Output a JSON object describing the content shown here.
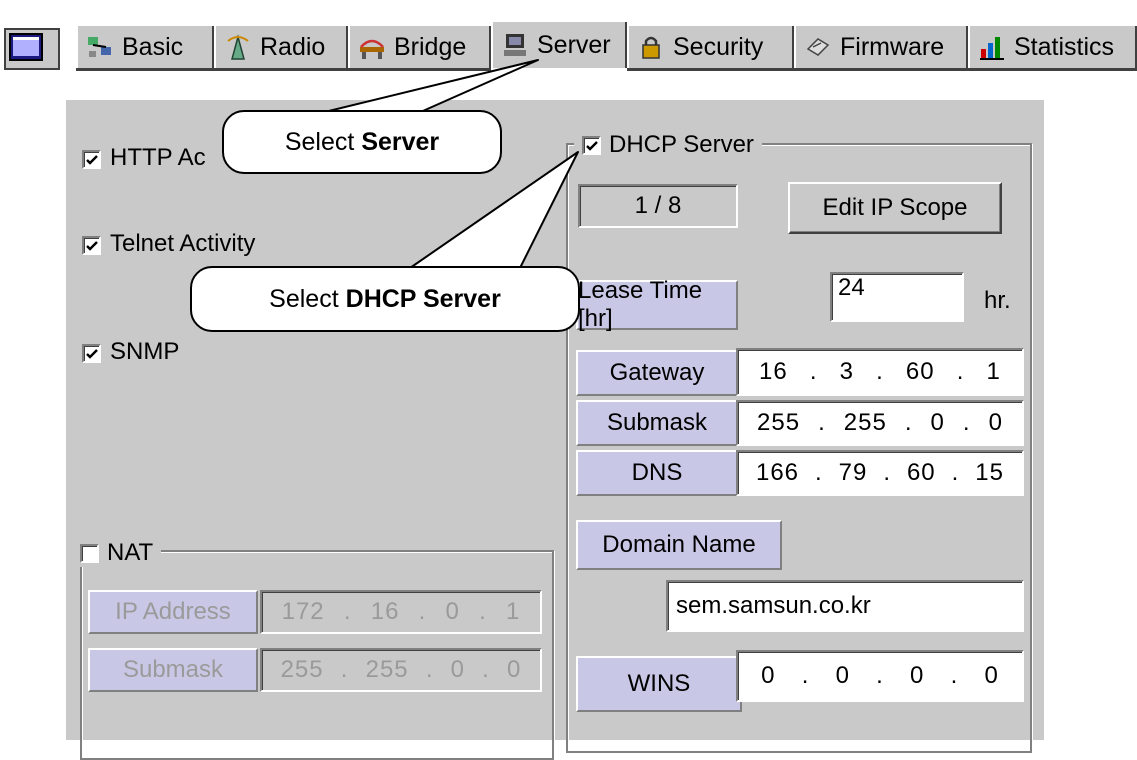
{
  "tabs": [
    {
      "label": "Basic",
      "icon": "network-map-icon"
    },
    {
      "label": "Radio",
      "icon": "radio-tower-icon"
    },
    {
      "label": "Bridge",
      "icon": "bridge-icon"
    },
    {
      "label": "Server",
      "icon": "server-computer-icon",
      "selected": true
    },
    {
      "label": "Security",
      "icon": "security-padlock-icon"
    },
    {
      "label": "Firmware",
      "icon": "firmware-chip-icon"
    },
    {
      "label": "Statistics",
      "icon": "bar-chart-icon"
    }
  ],
  "left": {
    "http_label": "HTTP Ac",
    "http_checked": true,
    "telnet_label": "Telnet Activity",
    "telnet_checked": true,
    "snmp_label": "SNMP",
    "snmp_checked": true
  },
  "nat": {
    "title": "NAT",
    "checked": false,
    "ip_label": "IP Address",
    "ip_value": [
      "172",
      "16",
      "0",
      "1"
    ],
    "submask_label": "Submask",
    "submask_value": [
      "255",
      "255",
      "0",
      "0"
    ]
  },
  "dhcp": {
    "title": "DHCP Server",
    "checked": true,
    "scope_count": "1 / 8",
    "edit_scope_button": "Edit IP Scope",
    "lease_label": "Lease Time [hr]",
    "lease_value": "24",
    "lease_unit": "hr.",
    "gateway_label": "Gateway",
    "gateway_value": [
      "16",
      "3",
      "60",
      "1"
    ],
    "submask_label": "Submask",
    "submask_value": [
      "255",
      "255",
      "0",
      "0"
    ],
    "dns_label": "DNS",
    "dns_value": [
      "166",
      "79",
      "60",
      "15"
    ],
    "domain_label": "Domain Name",
    "domain_value": "sem.samsun.co.kr",
    "wins_label": "WINS",
    "wins_value": [
      "0",
      "0",
      "0",
      "0"
    ]
  },
  "callouts": {
    "server_prefix": "Select",
    "server_bold": "Server",
    "dhcp_prefix": "Select",
    "dhcp_bold": "DHCP Server"
  },
  "colors": {
    "panel": "#c9c9c9",
    "label_fill": "#c8c8e6",
    "disabled_text": "#9a9a9a"
  }
}
